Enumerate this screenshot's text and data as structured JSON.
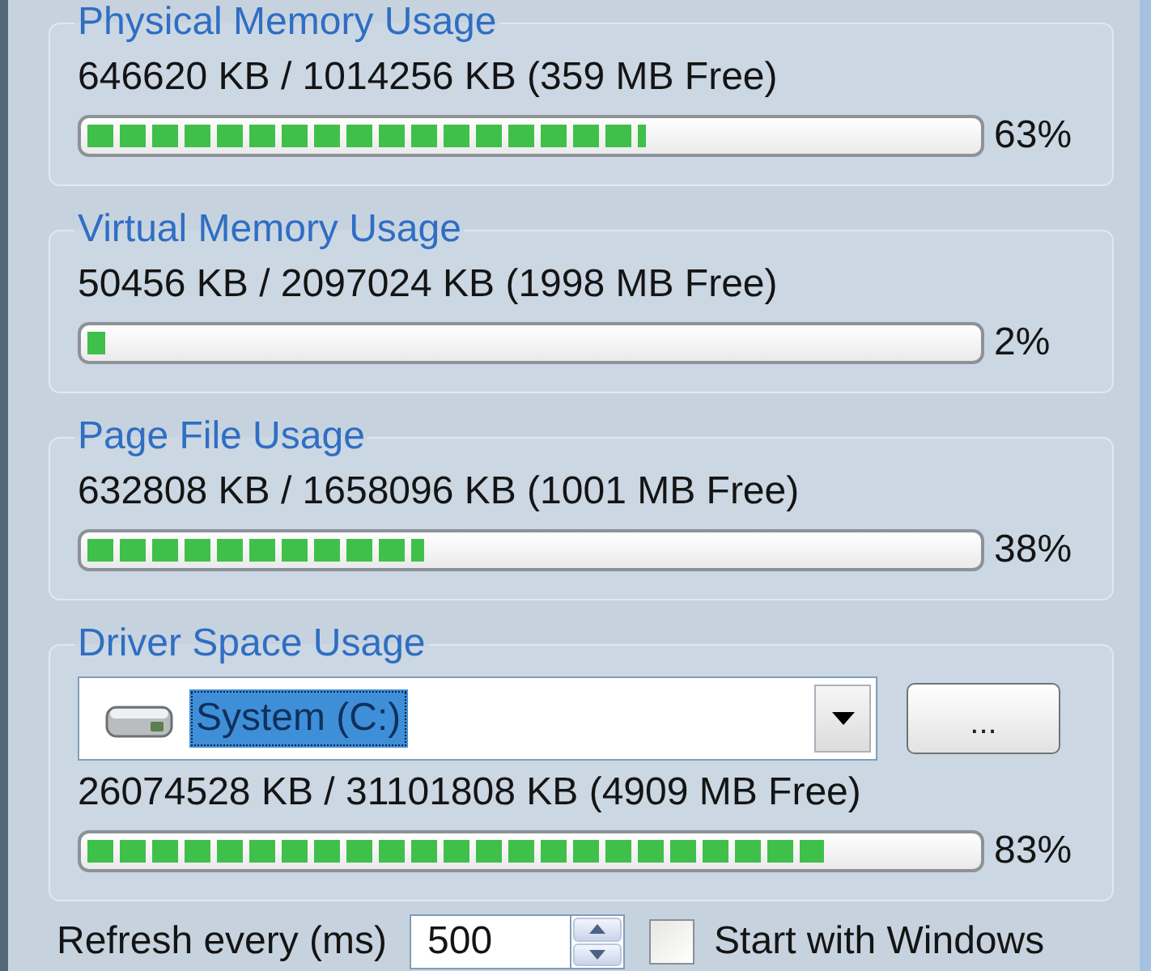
{
  "groups": [
    {
      "kind": "meter",
      "title": "Physical Memory Usage",
      "usage": "646620 KB / 1014256 KB (359 MB Free)",
      "level": 0.63,
      "percent": "63%"
    },
    {
      "kind": "meter",
      "title": "Virtual Memory Usage",
      "usage": "50456 KB / 2097024 KB (1998 MB Free)",
      "level": 0.02,
      "percent": "2%"
    },
    {
      "kind": "meter",
      "title": "Page File Usage",
      "usage": "632808 KB / 1658096 KB (1001 MB Free)",
      "level": 0.38,
      "percent": "38%"
    },
    {
      "kind": "drive",
      "title": "Driver Space Usage",
      "drive_select": {
        "value": "System (C:)"
      },
      "browse_button": "...",
      "usage": "26074528 KB / 31101808 KB (4909 MB Free)",
      "level": 0.83,
      "percent": "83%"
    }
  ],
  "refresh": {
    "label": "Refresh every (ms)",
    "value": "500"
  },
  "start_with_windows": {
    "label": "Start with Windows",
    "checked": false
  }
}
